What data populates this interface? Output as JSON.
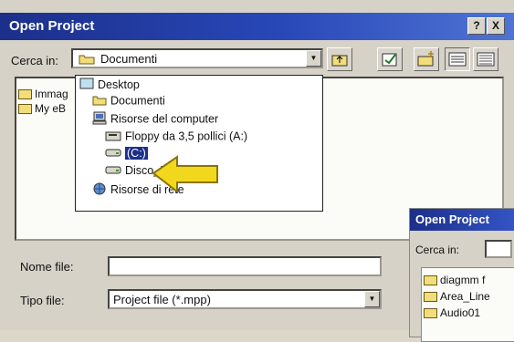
{
  "dialog": {
    "title": "Open Project",
    "help_label": "?",
    "close_label": "X",
    "look_in_label": "Cerca in:",
    "look_in_value": "Documenti",
    "filename_label": "Nome file:",
    "filename_value": "",
    "filetype_label": "Tipo file:",
    "filetype_value": "Project file (*.mpp)"
  },
  "files": [
    {
      "name": "Immag"
    },
    {
      "name": "My eB"
    }
  ],
  "dropdown": {
    "items": [
      {
        "label": "Desktop",
        "icon": "desktop-icon"
      },
      {
        "label": "Documenti",
        "icon": "folder-open-icon"
      },
      {
        "label": "Risorse del computer",
        "icon": "computer-icon"
      },
      {
        "label": "Floppy da 3,5 pollici (A:)",
        "icon": "floppy-icon"
      },
      {
        "label": "(C:)",
        "icon": "hard-drive-icon",
        "selected": true
      },
      {
        "label": "Disco_D (D:)",
        "icon": "hard-drive-icon"
      },
      {
        "label": "Risorse di rete",
        "icon": "network-icon"
      }
    ]
  },
  "second_dialog": {
    "title": "Open Project",
    "look_in_label": "Cerca in:",
    "files": [
      "diagmm f",
      "Area_Line",
      "Audio01"
    ]
  },
  "colors": {
    "title_bar": "#1c2f8a",
    "highlight_arrow": "#f2d81c"
  }
}
